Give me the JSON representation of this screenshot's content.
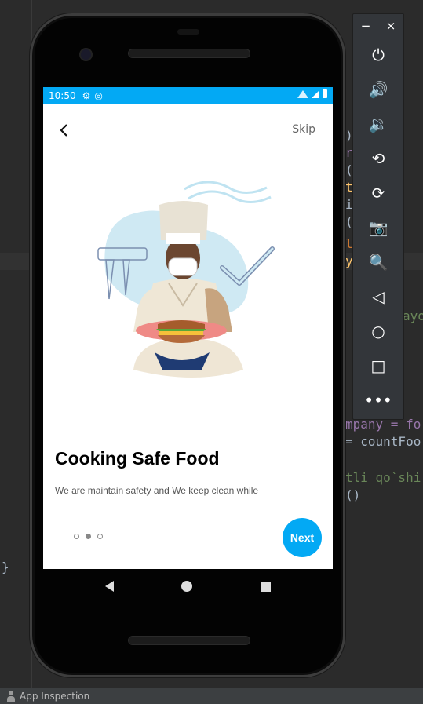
{
  "ide": {
    "code_fragments": [
      {
        "text": ")."
      },
      {
        "text": "t"
      },
      {
        "text": "ri"
      },
      {
        "text": "()."
      },
      {
        "text": "tri"
      },
      {
        "text": "ing"
      },
      {
        "text": "()."
      },
      {
        "text": "l f"
      },
      {
        "text": "y()"
      },
      {
        "text": "ayo"
      },
      {
        "text": "mpany = fo"
      },
      {
        "text": "= countFoo"
      },
      {
        "text": "tli qo`shi"
      },
      {
        "text": "()"
      },
      {
        "text": "}"
      }
    ],
    "status_bar": {
      "label": "App Inspection"
    }
  },
  "phone": {
    "status_bar": {
      "time": "10:50",
      "gear_icon": "gear-icon",
      "sync_icon": "sync-icon"
    },
    "header": {
      "skip_label": "Skip"
    },
    "onboarding": {
      "title": "Cooking Safe Food",
      "description": "We are maintain safety and We keep clean while making food.",
      "page_index": 1,
      "page_count": 3,
      "next_label": "Next"
    },
    "colors": {
      "accent": "#03a9f4"
    }
  },
  "emulator": {
    "minimize_label": "−",
    "close_label": "×",
    "buttons": [
      {
        "name": "power-icon",
        "glyph": "⏻"
      },
      {
        "name": "volume-up-icon",
        "glyph": "🔊"
      },
      {
        "name": "volume-down-icon",
        "glyph": "🔉"
      },
      {
        "name": "rotate-left-icon",
        "glyph": "⟲"
      },
      {
        "name": "rotate-right-icon",
        "glyph": "⟳"
      },
      {
        "name": "camera-icon",
        "glyph": "📷"
      },
      {
        "name": "zoom-icon",
        "glyph": "🔍"
      },
      {
        "name": "back-icon",
        "glyph": "◁"
      },
      {
        "name": "home-icon",
        "glyph": "○"
      },
      {
        "name": "overview-icon",
        "glyph": "□"
      },
      {
        "name": "more-icon",
        "glyph": "•••"
      }
    ]
  }
}
